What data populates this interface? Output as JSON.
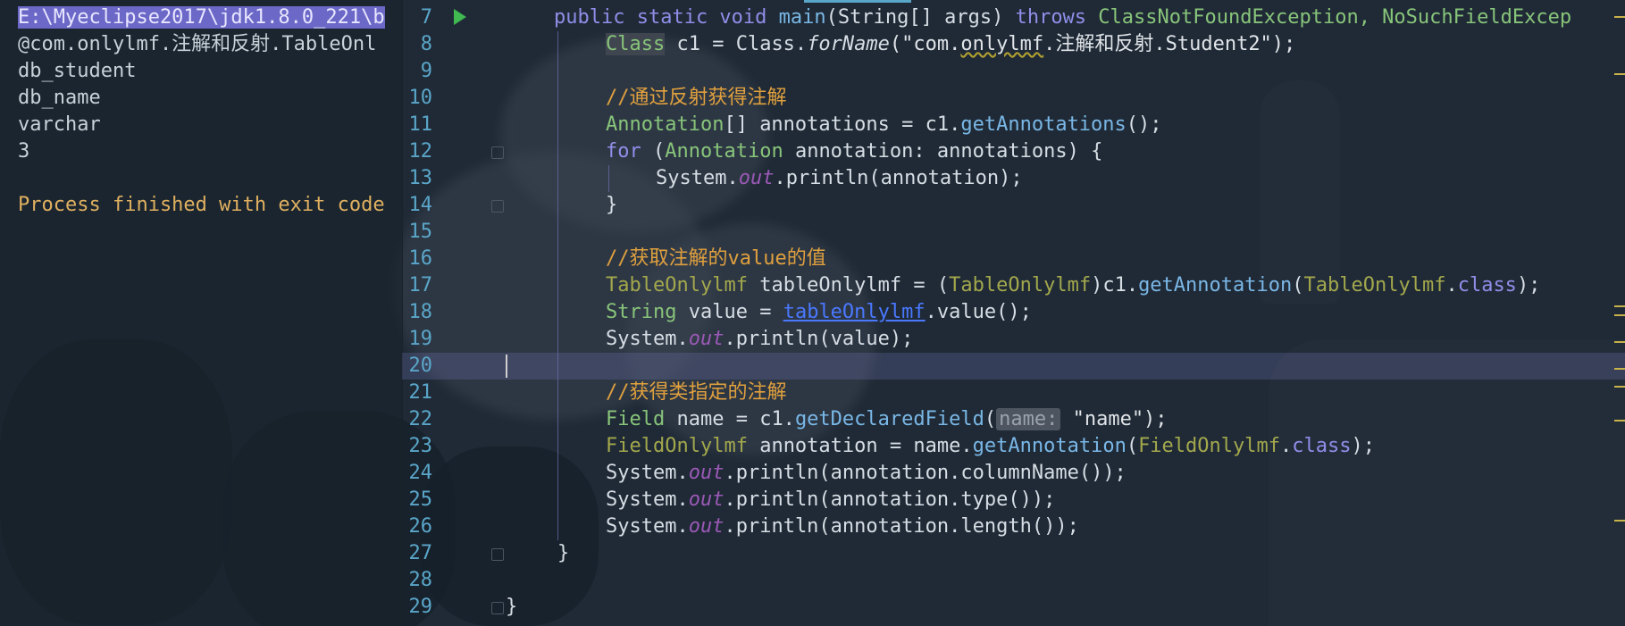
{
  "console": {
    "lines": [
      "E:\\Myeclipse2017\\jdk1.8.0_221\\b",
      "@com.onlylmf.注解和反射.TableOnl",
      "db_student",
      "db_name",
      "varchar",
      "3",
      "",
      "Process finished with exit code"
    ]
  },
  "editor": {
    "line_numbers": [
      "7",
      "8",
      "9",
      "10",
      "11",
      "12",
      "13",
      "14",
      "15",
      "16",
      "17",
      "18",
      "19",
      "20",
      "21",
      "22",
      "23",
      "24",
      "25",
      "26",
      "27",
      "28",
      "29"
    ],
    "lines": {
      "l7": {
        "kw1": "public static void ",
        "m": "main",
        "p1": "(String[] args) ",
        "kw2": "throws ",
        "c1": "ClassNotFoundException, NoSuchFieldExcep"
      },
      "l8": {
        "cls": "Class",
        "a": " c1 = Class.",
        "fn": "forName",
        "b": "(\"com.",
        "sq": "onlylmf",
        "c": ".注解和反射.Student2\");"
      },
      "l10": {
        "com": "//通过反射获得注解"
      },
      "l11": {
        "cls": "Annotation",
        "a": "[] annotations = c1.",
        "m": "getAnnotations",
        "b": "();"
      },
      "l12": {
        "kw": "for",
        "a": " (",
        "cls": "Annotation",
        "b": " annotation: annotations) {"
      },
      "l13": {
        "a": "System.",
        "fld": "out",
        "b": ".println(annotation);"
      },
      "l14": {
        "a": "}"
      },
      "l16": {
        "com": "//获取注解的value的值"
      },
      "l17": {
        "ann1": "TableOnlylmf",
        "a": " tableOnlylmf = (",
        "ann2": "TableOnlylmf",
        "b": ")c1.",
        "m": "getAnnotation",
        "c": "(",
        "ann3": "TableOnlylmf",
        "d": ".",
        "kw": "class",
        "e": ");"
      },
      "l18": {
        "cls": "String",
        "a": " value = ",
        "link": "tableOnlylmf",
        "b": ".value();"
      },
      "l19": {
        "a": "System.",
        "fld": "out",
        "b": ".println(value);"
      },
      "l21": {
        "com": "//获得类指定的注解"
      },
      "l22": {
        "cls": "Field",
        "a": " name = c1.",
        "m": "getDeclaredField",
        "b": "(",
        "hint": "name:",
        "c": " \"name\");"
      },
      "l23": {
        "ann1": "FieldOnlylmf",
        "a": " annotation = name.",
        "m": "getAnnotation",
        "b": "(",
        "ann2": "FieldOnlylmf",
        "c": ".",
        "kw": "class",
        "d": ");"
      },
      "l24": {
        "a": "System.",
        "fld": "out",
        "b": ".println(annotation.columnName());"
      },
      "l25": {
        "a": "System.",
        "fld": "out",
        "b": ".println(annotation.type());"
      },
      "l26": {
        "a": "System.",
        "fld": "out",
        "b": ".println(annotation.length());"
      },
      "l27": {
        "a": "}"
      },
      "l29": {
        "a": "}"
      }
    }
  },
  "colors": {
    "keyword": "#8f8ee8",
    "class": "#88c47a",
    "annotation": "#a3a84c",
    "comment": "#e0a03e",
    "field": "#9b59b6",
    "method": "#7ab7e6",
    "line_number": "#5aa6c9"
  }
}
